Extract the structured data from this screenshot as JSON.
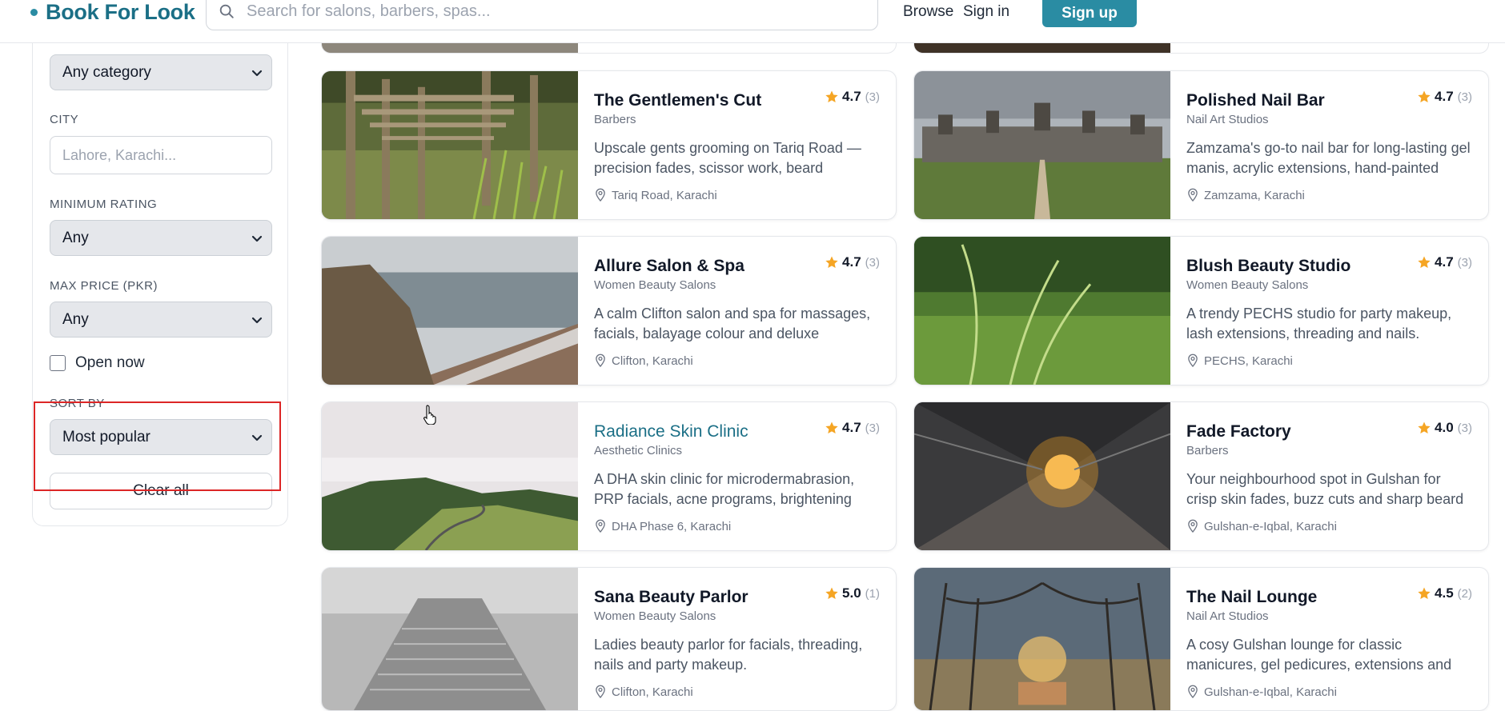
{
  "header": {
    "logo": "Book For Look",
    "search_placeholder": "Search for salons, barbers, spas...",
    "nav_browse": "Browse",
    "nav_signin": "Sign in",
    "signup": "Sign up"
  },
  "colors": {
    "brand": "#1b6f86",
    "accent": "#2a8ca3",
    "star": "#f5a524",
    "highlight": "#dc2626"
  },
  "filters": {
    "category_value": "Any category",
    "city_label": "CITY",
    "city_placeholder": "Lahore, Karachi...",
    "min_rating_label": "MINIMUM RATING",
    "min_rating_value": "Any",
    "max_price_label": "MAX PRICE (PKR)",
    "max_price_value": "Any",
    "open_now_label": "Open now",
    "sort_label": "SORT BY",
    "sort_value": "Most popular",
    "clear_all": "Clear all"
  },
  "listings": [
    {
      "name": "The Gentlemen's Cut",
      "category": "Barbers",
      "rating": "4.7",
      "count": "(3)",
      "description": "Upscale gents grooming on Tariq Road — precision fades, scissor work, beard sculptin...",
      "location": "Tariq Road, Karachi",
      "image": "wooden-pier-photo"
    },
    {
      "name": "Polished Nail Bar",
      "category": "Nail Art Studios",
      "rating": "4.7",
      "count": "(3)",
      "description": "Zamzama's go-to nail bar for long-lasting gel manis, acrylic extensions, hand-painted nail...",
      "location": "Zamzama, Karachi",
      "image": "chateau-photo"
    },
    {
      "name": "Allure Salon & Spa",
      "category": "Women Beauty Salons",
      "rating": "4.7",
      "count": "(3)",
      "description": "A calm Clifton salon and spa for massages, facials, balayage colour and deluxe pedicures.",
      "location": "Clifton, Karachi",
      "image": "beach-cliff-photo"
    },
    {
      "name": "Blush Beauty Studio",
      "category": "Women Beauty Salons",
      "rating": "4.7",
      "count": "(3)",
      "description": "A trendy PECHS studio for party makeup, lash extensions, threading and nails.",
      "location": "PECHS, Karachi",
      "image": "grass-photo"
    },
    {
      "name": "Radiance Skin Clinic",
      "category": "Aesthetic Clinics",
      "rating": "4.7",
      "count": "(3)",
      "description": "A DHA skin clinic for microdermabrasion, PRP facials, acne programs, brightening peels an...",
      "location": "DHA Phase 6, Karachi",
      "image": "misty-hills-photo"
    },
    {
      "name": "Fade Factory",
      "category": "Barbers",
      "rating": "4.0",
      "count": "(3)",
      "description": "Your neighbourhood spot in Gulshan for crisp skin fades, buzz cuts and sharp beard line-...",
      "location": "Gulshan-e-Iqbal, Karachi",
      "image": "train-station-photo"
    },
    {
      "name": "Sana Beauty Parlor",
      "category": "Women Beauty Salons",
      "rating": "5.0",
      "count": "(1)",
      "description": "Ladies beauty parlor for facials, threading, nails and party makeup.",
      "location": "Clifton, Karachi",
      "image": "foggy-stairs-photo"
    },
    {
      "name": "The Nail Lounge",
      "category": "Nail Art Studios",
      "rating": "4.5",
      "count": "(2)",
      "description": "A cosy Gulshan lounge for classic manicures, gel pedicures, extensions and quick nail...",
      "location": "Gulshan-e-Iqbal, Karachi",
      "image": "tree-avenue-photo"
    }
  ]
}
